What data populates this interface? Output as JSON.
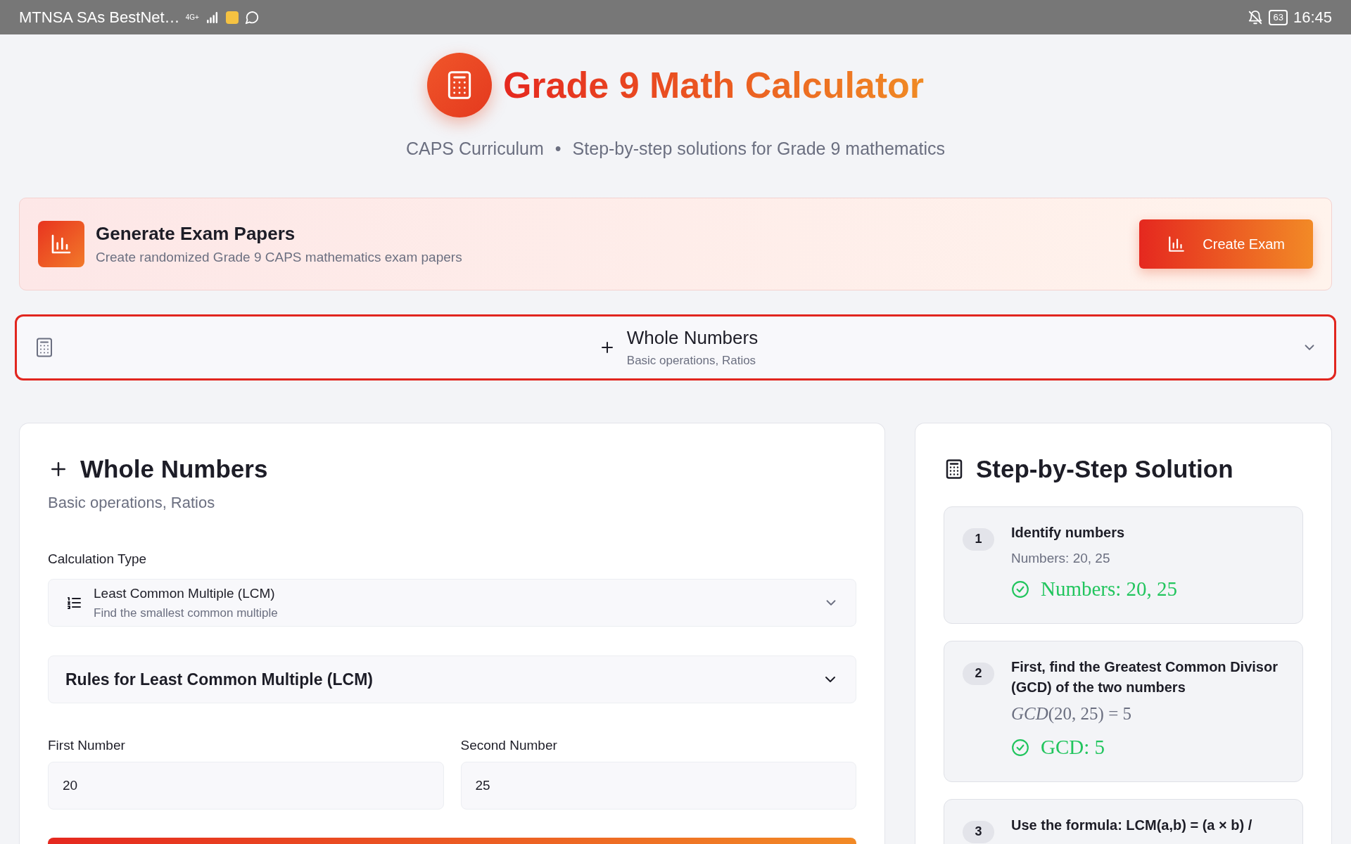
{
  "status_bar": {
    "carrier": "MTNSA SAs BestNet…",
    "network": "4G+",
    "battery": "63",
    "time": "16:45"
  },
  "header": {
    "title": "Grade 9 Math Calculator",
    "subtitle_parts": [
      "CAPS Curriculum",
      "•",
      "Step-by-step solutions for Grade 9 mathematics"
    ]
  },
  "exam_banner": {
    "title": "Generate Exam Papers",
    "description": "Create randomized Grade 9 CAPS mathematics exam papers",
    "button": "Create Exam"
  },
  "topic_select": {
    "title": "Whole Numbers",
    "subtitle": "Basic operations, Ratios",
    "selected": true
  },
  "calculator": {
    "title": "Whole Numbers",
    "subtitle": "Basic operations, Ratios",
    "type_label": "Calculation Type",
    "type": {
      "title": "Least Common Multiple (LCM)",
      "description": "Find the smallest common multiple"
    },
    "rules": {
      "title": "Rules for Least Common Multiple (LCM)",
      "expanded": false
    },
    "inputs": [
      {
        "label": "First Number",
        "value": "20"
      },
      {
        "label": "Second Number",
        "value": "25"
      }
    ]
  },
  "solution": {
    "title": "Step-by-Step Solution",
    "steps": [
      {
        "number": "1",
        "title": "Identify numbers",
        "kind": "text",
        "detail": "Numbers: 20, 25",
        "result": "Numbers: 20, 25"
      },
      {
        "number": "2",
        "title": "First, find the Greatest Common Divisor (GCD) of the two numbers",
        "kind": "math",
        "detail": "*GCD*(20, 25) = 5",
        "result": "GCD: 5"
      },
      {
        "number": "3",
        "title": "Use the formula: LCM(a,b) = (a × b) /"
      }
    ]
  }
}
